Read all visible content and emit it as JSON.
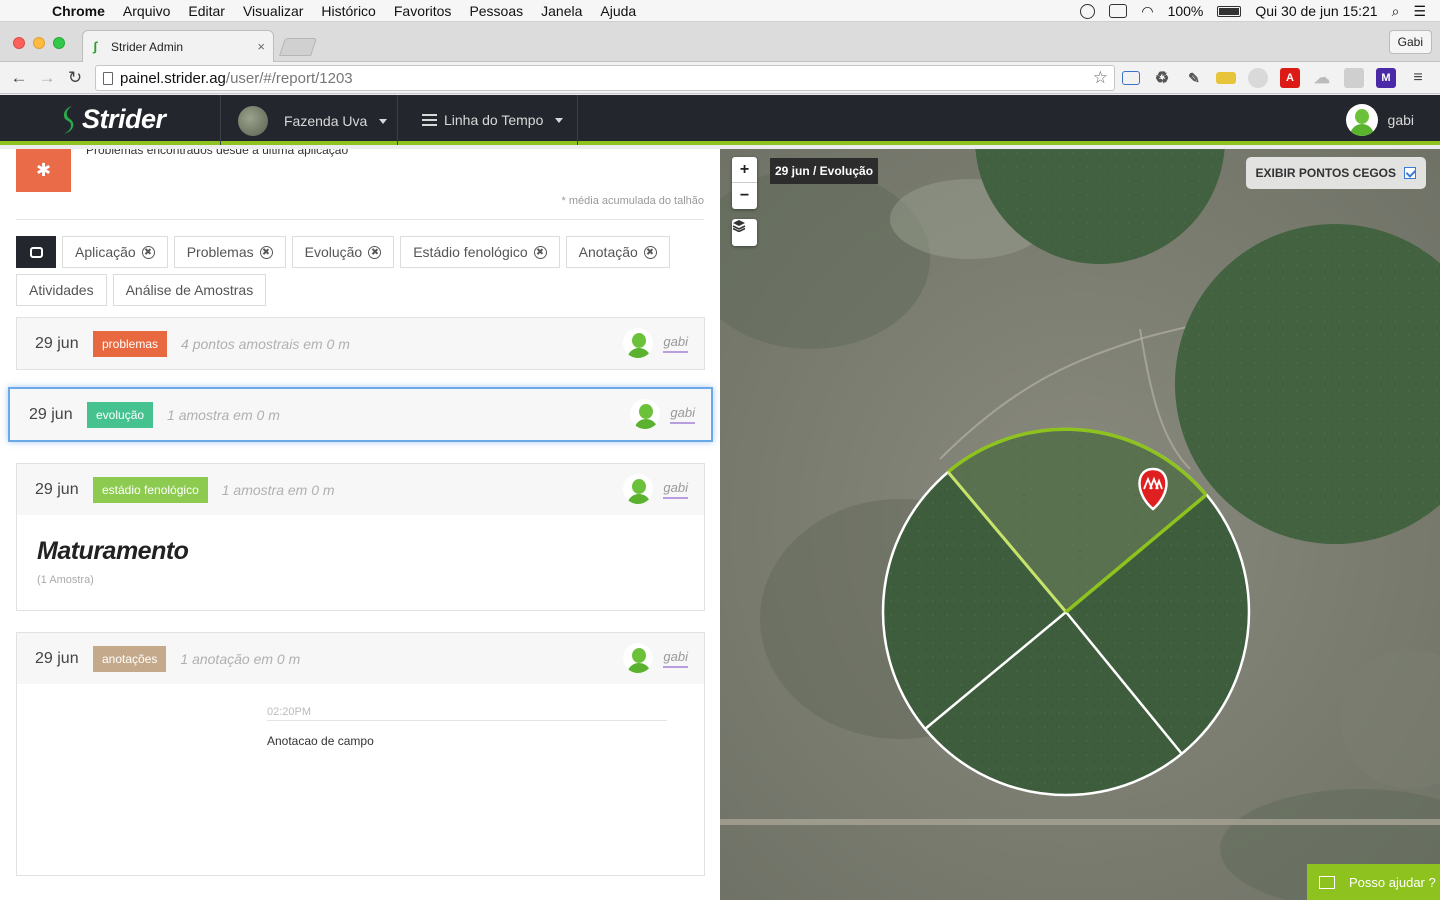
{
  "menubar": {
    "app": "Chrome",
    "items": [
      "Arquivo",
      "Editar",
      "Visualizar",
      "Histórico",
      "Favoritos",
      "Pessoas",
      "Janela",
      "Ajuda"
    ],
    "battery": "100%",
    "clock": "Qui 30 de jun  15:21"
  },
  "browser": {
    "tab_title": "Strider Admin",
    "profile": "Gabi",
    "url_host": "painel.strider.ag",
    "url_path": "/user/#/report/1203"
  },
  "header": {
    "logo": "Strider",
    "farm": "Fazenda Uva",
    "timeline": "Linha do Tempo",
    "user": "gabi"
  },
  "left": {
    "truncated_text": "Problemas encontrados desde a última aplicação",
    "note": "* média acumulada do talhão",
    "filters_row1": [
      "Aplicação",
      "Problemas",
      "Evolução",
      "Estádio fenológico",
      "Anotação"
    ],
    "filters_row2": [
      "Atividades",
      "Análise de Amostras"
    ],
    "cards": [
      {
        "date": "29 jun",
        "tag": "problemas",
        "tag_color": "#e8683f",
        "meta": "4 pontos amostrais em 0 m",
        "user": "gabi"
      },
      {
        "date": "29 jun",
        "tag": "evolução",
        "tag_color": "#45c28f",
        "meta": "1 amostra em 0 m",
        "user": "gabi"
      },
      {
        "date": "29 jun",
        "tag": "estádio fenológico",
        "tag_color": "#8ccb4f",
        "meta": "1 amostra em 0 m",
        "user": "gabi",
        "title": "Maturamento",
        "subtitle": "(1 Amostra)"
      },
      {
        "date": "29 jun",
        "tag": "anotações",
        "tag_color": "#c4a98a",
        "meta": "1 anotação em 0 m",
        "user": "gabi",
        "note_time": "02:20PM",
        "note_text": "Anotacao de campo"
      }
    ]
  },
  "map": {
    "zoom_in": "+",
    "zoom_out": "−",
    "label": "29 jun / Evolução",
    "blind_spots": "EXIBIR PONTOS CEGOS",
    "help": "Posso ajudar ?"
  }
}
